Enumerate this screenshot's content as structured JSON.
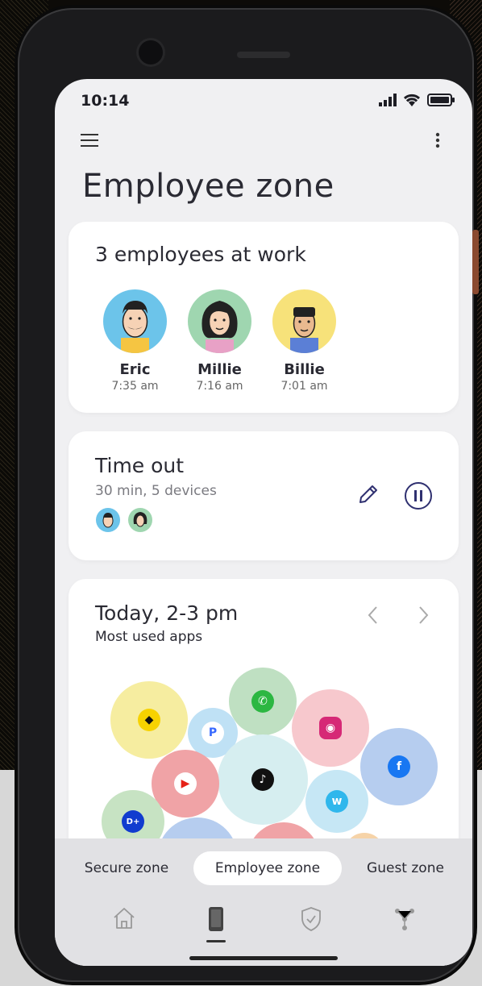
{
  "status": {
    "time": "10:14"
  },
  "page": {
    "title": "Employee zone"
  },
  "employees_card": {
    "title": "3 employees at work",
    "employees": [
      {
        "name": "Eric",
        "time": "7:35 am",
        "color": "#6cc4ea"
      },
      {
        "name": "Millie",
        "time": "7:16 am",
        "color": "#9fd6b0"
      },
      {
        "name": "Billie",
        "time": "7:01 am",
        "color": "#f7e27a"
      }
    ]
  },
  "timeout_card": {
    "title": "Time out",
    "subtitle": "30 min, 5 devices"
  },
  "apps_card": {
    "title": "Today, 2-3 pm",
    "subtitle": "Most used apps",
    "apps": [
      {
        "name": "snapchat",
        "color": "#f6eda0",
        "icon_color": "#f7d200"
      },
      {
        "name": "whatsapp",
        "color": "#bfe0c2",
        "icon_color": "#2cb742"
      },
      {
        "name": "pandora",
        "color": "#bfe1f5",
        "icon_color": "#3668ff"
      },
      {
        "name": "instagram",
        "color": "#f7c8cd",
        "icon_color": "#d62976"
      },
      {
        "name": "tiktok",
        "color": "#d6eef0",
        "icon_color": "#111111"
      },
      {
        "name": "youtube",
        "color": "#f0a3a6",
        "icon_color": "#e62117"
      },
      {
        "name": "facebook",
        "color": "#b6cdef",
        "icon_color": "#1877f2"
      },
      {
        "name": "wish",
        "color": "#c6e7f5",
        "icon_color": "#2fb7ec"
      },
      {
        "name": "disney",
        "color": "#c7e3c3",
        "icon_color": "#113ccf"
      }
    ]
  },
  "zones": {
    "secure": "Secure zone",
    "employee": "Employee zone",
    "guest": "Guest zone"
  },
  "nav": [
    "home-icon",
    "phone-icon",
    "shield-icon",
    "network-icon"
  ]
}
